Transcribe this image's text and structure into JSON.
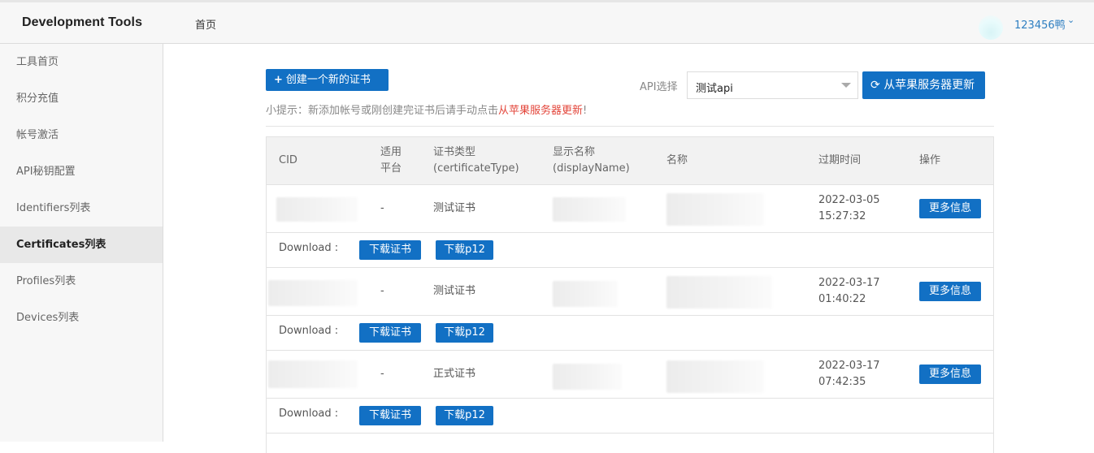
{
  "header": {
    "brand": "Development Tools",
    "home": "首页",
    "user": "123456鸭"
  },
  "sidebar": {
    "items": [
      {
        "label": "工具首页",
        "active": false
      },
      {
        "label": "积分充值",
        "active": false
      },
      {
        "label": "帐号激活",
        "active": false
      },
      {
        "label": "API秘钥配置",
        "active": false
      },
      {
        "label": "Identifiers列表",
        "active": false
      },
      {
        "label": "Certificates列表",
        "active": true
      },
      {
        "label": "Profiles列表",
        "active": false
      },
      {
        "label": "Devices列表",
        "active": false
      }
    ]
  },
  "toolbar": {
    "create_label": "创建一个新的证书",
    "api_label": "API选择",
    "api_selected": "测试api",
    "refresh_label": "从苹果服务器更新",
    "tip_prefix": "小提示：新添加帐号或刚创建完证书后请手动点击",
    "tip_highlight": "从苹果服务器更新",
    "tip_suffix": "!"
  },
  "table": {
    "headers": {
      "cid": "CID",
      "platform_line1": "适用",
      "platform_line2": "平台",
      "type_line1": "证书类型",
      "type_line2": "(certificateType)",
      "display_line1": "显示名称",
      "display_line2": "(displayName)",
      "name": "名称",
      "expire": "过期时间",
      "action": "操作"
    },
    "download_label": "Download :",
    "download_cert": "下载证书",
    "download_p12": "下载p12",
    "more_label": "更多信息",
    "rows": [
      {
        "platform": "-",
        "type": "测试证书",
        "expire_date": "2022-03-05",
        "expire_time": "15:27:32"
      },
      {
        "platform": "-",
        "type": "测试证书",
        "expire_date": "2022-03-17",
        "expire_time": "01:40:22"
      },
      {
        "platform": "-",
        "type": "正式证书",
        "expire_date": "2022-03-17",
        "expire_time": "07:42:35"
      }
    ]
  },
  "colors": {
    "primary": "#1270c4",
    "highlight": "#e3453a",
    "link": "#2f7fc1"
  }
}
